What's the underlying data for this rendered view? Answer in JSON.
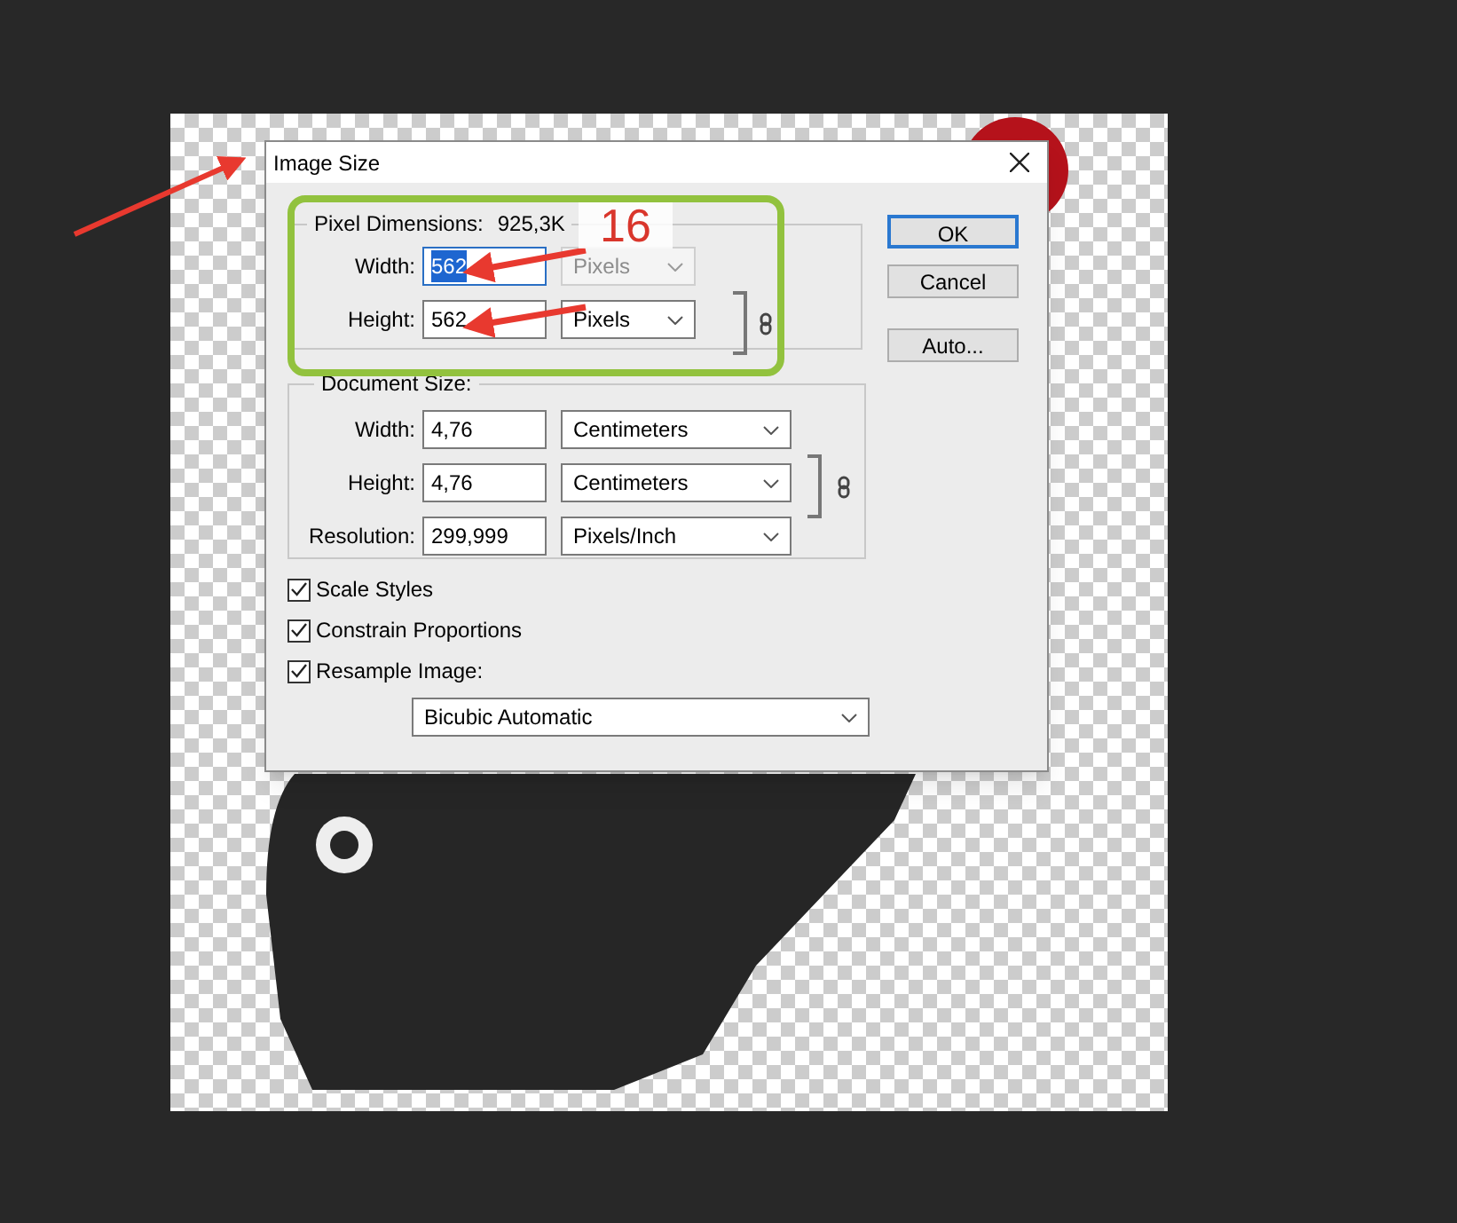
{
  "window": {
    "title": "Image Size"
  },
  "pixel_dimensions": {
    "label": "Pixel Dimensions:",
    "value": "925,3K",
    "fields": [
      {
        "label": "Width:",
        "value": "562",
        "selected": true,
        "unit": "Pixels",
        "unit_disabled": true
      },
      {
        "label": "Height:",
        "value": "562",
        "selected": false,
        "unit": "Pixels",
        "unit_disabled": false
      }
    ]
  },
  "document_size": {
    "label": "Document Size:",
    "linked": true,
    "fields": [
      {
        "label": "Width:",
        "value": "4,76",
        "unit": "Centimeters"
      },
      {
        "label": "Height:",
        "value": "4,76",
        "unit": "Centimeters"
      },
      {
        "label": "Resolution:",
        "value": "299,999",
        "unit": "Pixels/Inch"
      }
    ]
  },
  "options": [
    {
      "label": "Scale Styles",
      "checked": true
    },
    {
      "label": "Constrain Proportions",
      "checked": true
    },
    {
      "label": "Resample Image:",
      "checked": true
    }
  ],
  "resample_method": "Bicubic Automatic",
  "buttons": [
    {
      "label": "OK",
      "default": true
    },
    {
      "label": "Cancel",
      "default": false
    },
    {
      "label": "Auto...",
      "default": false
    }
  ],
  "annotation": {
    "label": "16"
  }
}
